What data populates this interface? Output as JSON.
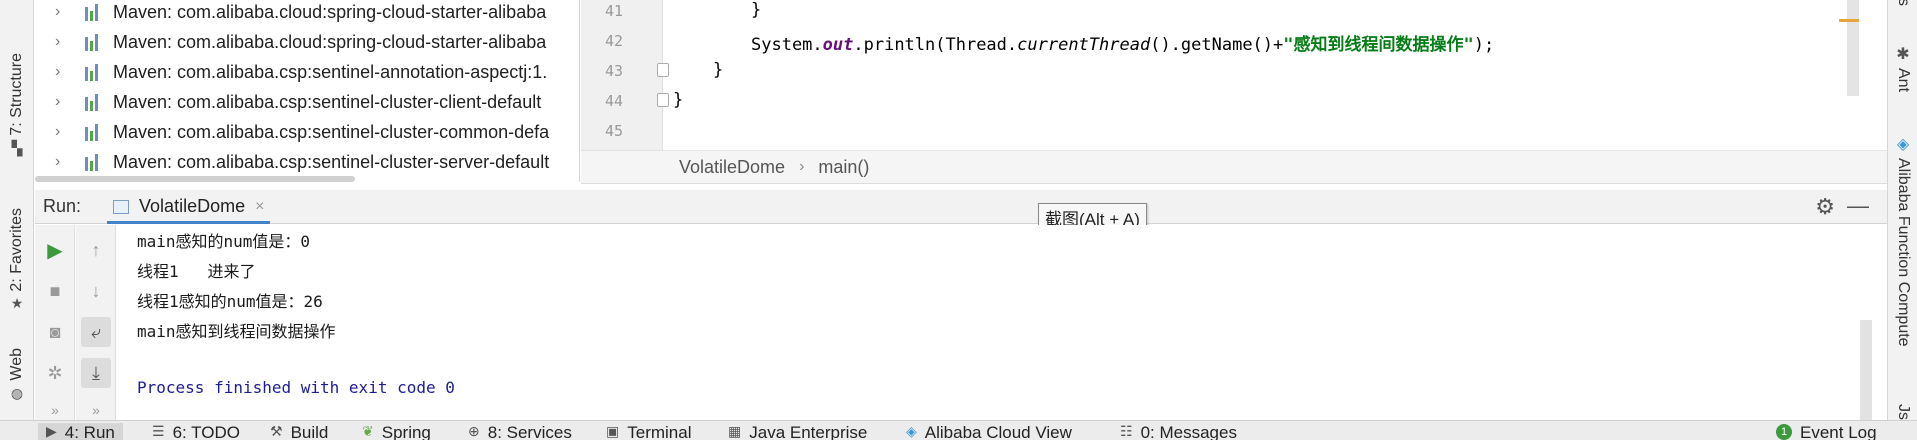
{
  "left_tabs": [
    {
      "label": "7: Structure",
      "icon": "structure-icon"
    },
    {
      "label": "2: Favorites",
      "icon": "star-icon"
    },
    {
      "label": "Web",
      "icon": "web-icon"
    }
  ],
  "right_tabs": [
    {
      "label": "s",
      "icon": ""
    },
    {
      "label": "Ant",
      "icon": "ant-icon"
    },
    {
      "label": "Alibaba Function Compute",
      "icon": "alibaba-cloud-icon"
    },
    {
      "label": "Js",
      "icon": ""
    }
  ],
  "tree": {
    "items": [
      "Maven: com.alibaba.cloud:spring-cloud-starter-alibaba",
      "Maven: com.alibaba.cloud:spring-cloud-starter-alibaba",
      "Maven: com.alibaba.csp:sentinel-annotation-aspectj:1.",
      "Maven: com.alibaba.csp:sentinel-cluster-client-default",
      "Maven: com.alibaba.csp:sentinel-cluster-common-defa",
      "Maven: com.alibaba.csp:sentinel-cluster-server-default"
    ]
  },
  "editor": {
    "line_numbers": [
      "41",
      "42",
      "43",
      "44",
      "45"
    ],
    "line41": "}",
    "line42_a": "System.",
    "line42_b": "out",
    "line42_c": ".println(Thread.",
    "line42_d": "currentThread",
    "line42_e": "().getName()+",
    "line42_f": "\"感知到线程间数据操作\"",
    "line42_g": ");",
    "line43": "}",
    "line44": "}"
  },
  "breadcrumb": {
    "class_name": "VolatileDome",
    "separator": "›",
    "method": "main()"
  },
  "run_panel": {
    "title": "Run:",
    "tab_label": "VolatileDome",
    "close": "×",
    "gear": "⚙",
    "minimize": "—"
  },
  "tooltip": "截图(Alt + A)",
  "console": {
    "lines": [
      "main感知的num值是：0",
      "线程1   进来了",
      "线程1感知的num值是：26",
      "main感知到线程间数据操作",
      "",
      "Process finished with exit code 0"
    ]
  },
  "bottom_tabs": [
    {
      "label": "4: Run",
      "icon": "run-icon",
      "active": true
    },
    {
      "label": "6: TODO",
      "icon": "todo-icon"
    },
    {
      "label": "Build",
      "icon": "build-icon"
    },
    {
      "label": "Spring",
      "icon": "spring-icon"
    },
    {
      "label": "8: Services",
      "icon": "services-icon"
    },
    {
      "label": "Terminal",
      "icon": "terminal-icon"
    },
    {
      "label": "Java Enterprise",
      "icon": "java-enterprise-icon"
    },
    {
      "label": "Alibaba Cloud View",
      "icon": "alibaba-cloud-icon"
    },
    {
      "label": "0: Messages",
      "icon": "messages-icon"
    },
    {
      "label": "Event Log",
      "icon": "event-log-icon",
      "badge": "1"
    }
  ],
  "colors": {
    "accent": "#4083c9",
    "string": "#067d17",
    "static_field": "#660e7a",
    "exit_text": "#1c1c96",
    "run_green": "#3b9b3b"
  }
}
